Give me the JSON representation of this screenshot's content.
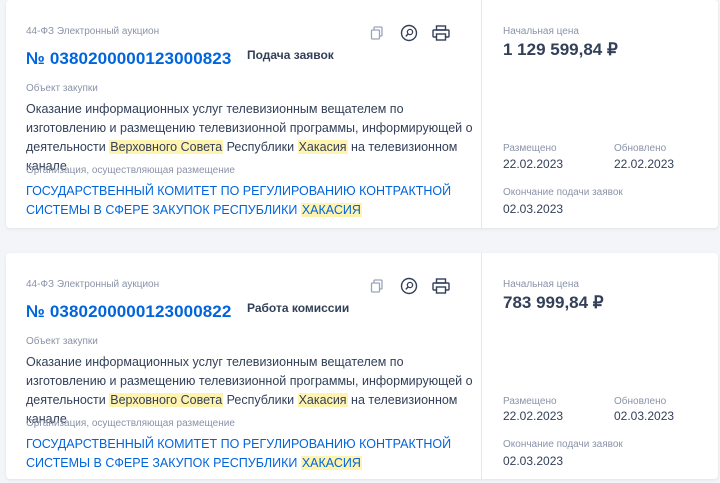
{
  "cards": [
    {
      "law": "44-ФЗ Электронный аукцион",
      "number": "№ 0380200000123000823",
      "status": "Подача заявок",
      "object_label": "Объект закупки",
      "desc_1": "Оказание информационных услуг телевизионным вещателем по изготовлению и размещению телевизионной программы, информирующей о деятельности ",
      "desc_hl1": "Верховного Совета",
      "desc_2": " Республики ",
      "desc_hl2": "Хакасия",
      "desc_3": " на телевизионном канале",
      "org_label": "Организация, осуществляющая размещение",
      "org_1": "ГОСУДАРСТВЕННЫЙ КОМИТЕТ ПО РЕГУЛИРОВАНИЮ КОНТРАКТНОЙ СИСТЕМЫ В СФЕРЕ ЗАКУПОК РЕСПУБЛИКИ ",
      "org_hl": "ХАКАСИЯ",
      "price_label": "Начальная цена",
      "price": "1 129 599,84 ₽",
      "placed_label": "Размещено",
      "placed": "22.02.2023",
      "updated_label": "Обновлено",
      "updated": "22.02.2023",
      "deadline_label": "Окончание подачи заявок",
      "deadline": "02.03.2023"
    },
    {
      "law": "44-ФЗ Электронный аукцион",
      "number": "№ 0380200000123000822",
      "status": "Работа комиссии",
      "object_label": "Объект закупки",
      "desc_1": "Оказание информационных услуг телевизионным вещателем по изготовлению и размещению телевизионной программы, информирующей о деятельности ",
      "desc_hl1": "Верховного Совета",
      "desc_2": " Республики ",
      "desc_hl2": "Хакасия",
      "desc_3": " на телевизионном канале",
      "org_label": "Организация, осуществляющая размещение",
      "org_1": "ГОСУДАРСТВЕННЫЙ КОМИТЕТ ПО РЕГУЛИРОВАНИЮ КОНТРАКТНОЙ СИСТЕМЫ В СФЕРЕ ЗАКУПОК РЕСПУБЛИКИ ",
      "org_hl": "ХАКАСИЯ",
      "price_label": "Начальная цена",
      "price": "783 999,84 ₽",
      "placed_label": "Размещено",
      "placed": "22.02.2023",
      "updated_label": "Обновлено",
      "updated": "02.03.2023",
      "deadline_label": "Окончание подачи заявок",
      "deadline": "02.03.2023"
    }
  ],
  "icons": [
    "copy-icon",
    "search-icon",
    "print-icon"
  ],
  "colors": {
    "link": "#0065dd",
    "highlight": "#fff3b0",
    "muted": "#8a93a8",
    "text": "#334059"
  }
}
